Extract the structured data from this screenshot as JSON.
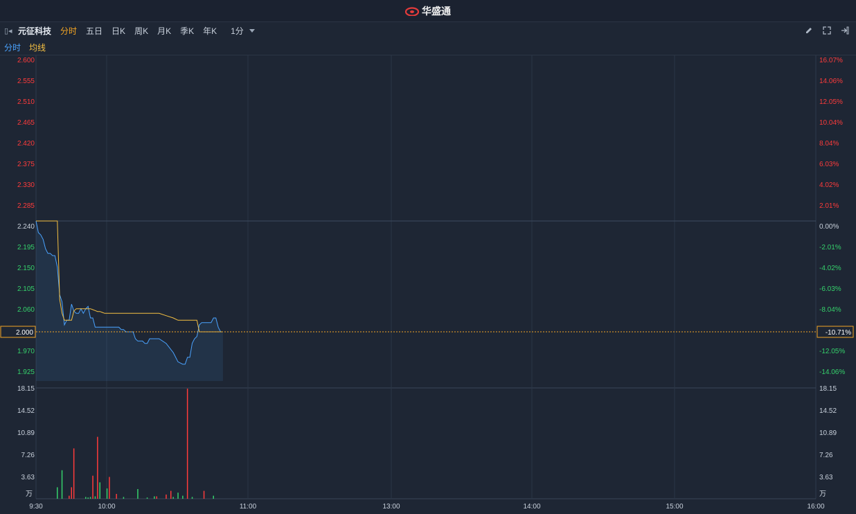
{
  "header": {
    "brand": "华盛通"
  },
  "toolbar": {
    "stock_name": "元征科技",
    "tabs": [
      "分时",
      "五日",
      "日K",
      "周K",
      "月K",
      "季K",
      "年K"
    ],
    "active_tab": "分时",
    "period": "1分"
  },
  "legend": {
    "price_label": "分时",
    "avg_label": "均线"
  },
  "colors": {
    "up": "#ff3b3b",
    "down": "#35d16b",
    "price_line": "#4aa3ff",
    "avg_line": "#f5c042",
    "current": "#f5a623"
  },
  "chart_data": {
    "type": "line",
    "prev_close": 2.24,
    "current_price": "2.000",
    "current_pct": "-10.71%",
    "price_ticks": [
      "2.600",
      "2.555",
      "2.510",
      "2.465",
      "2.420",
      "2.375",
      "2.330",
      "2.285",
      "2.240",
      "2.195",
      "2.150",
      "2.105",
      "2.060",
      "2.015",
      "1.970",
      "1.925"
    ],
    "pct_ticks": [
      "16.07%",
      "14.06%",
      "12.05%",
      "10.04%",
      "8.04%",
      "6.03%",
      "4.02%",
      "2.01%",
      "0.00%",
      "-2.01%",
      "-4.02%",
      "-6.03%",
      "-8.04%",
      "-10.04%",
      "-12.05%",
      "-14.06%"
    ],
    "volume_ticks": [
      "18.15",
      "14.52",
      "10.89",
      "7.26",
      "3.63"
    ],
    "volume_unit": "万",
    "time_labels": [
      "9:30",
      "10:00",
      "11:00",
      "13:00",
      "14:00",
      "15:00",
      "16:00"
    ],
    "price_minutes": [
      0,
      1,
      2,
      3,
      4,
      5,
      6,
      7,
      8,
      9,
      10,
      11,
      12,
      13,
      14,
      15,
      16,
      17,
      18,
      19,
      20,
      21,
      22,
      23,
      24,
      25,
      26,
      27,
      28,
      29,
      30,
      31,
      32,
      33,
      34,
      35,
      36,
      37,
      38,
      39,
      40,
      41,
      42,
      43,
      44,
      45,
      46,
      47,
      48,
      50,
      52,
      55,
      58,
      60,
      62,
      63,
      64,
      65,
      66,
      67,
      68,
      69,
      70,
      72,
      74,
      75,
      76,
      77,
      78,
      79
    ],
    "price": [
      2.24,
      2.215,
      2.21,
      2.2,
      2.18,
      2.17,
      2.17,
      2.165,
      2.165,
      2.14,
      2.08,
      2.065,
      2.015,
      2.025,
      2.025,
      2.06,
      2.045,
      2.04,
      2.04,
      2.05,
      2.04,
      2.05,
      2.055,
      2.03,
      2.03,
      2.01,
      2.01,
      2.01,
      2.01,
      2.01,
      2.01,
      2.01,
      2.01,
      2.01,
      2.01,
      2.01,
      2.005,
      2.005,
      2.0,
      2.0,
      2.0,
      2.0,
      1.985,
      1.98,
      1.98,
      1.98,
      1.975,
      1.975,
      1.985,
      1.985,
      1.985,
      1.975,
      1.955,
      1.935,
      1.93,
      1.93,
      1.945,
      1.945,
      1.975,
      1.985,
      1.99,
      2.015,
      2.02,
      2.02,
      2.02,
      2.03,
      2.03,
      2.01,
      2.0,
      2.0
    ],
    "avg": [
      2.24,
      2.24,
      2.24,
      2.24,
      2.24,
      2.24,
      2.24,
      2.24,
      2.24,
      2.24,
      2.07,
      2.04,
      2.025,
      2.025,
      2.025,
      2.025,
      2.045,
      2.05,
      2.05,
      2.05,
      2.05,
      2.05,
      2.05,
      2.05,
      2.048,
      2.046,
      2.044,
      2.044,
      2.042,
      2.04,
      2.04,
      2.04,
      2.04,
      2.04,
      2.04,
      2.04,
      2.04,
      2.04,
      2.04,
      2.04,
      2.04,
      2.04,
      2.04,
      2.04,
      2.04,
      2.04,
      2.04,
      2.04,
      2.04,
      2.04,
      2.04,
      2.035,
      2.03,
      2.025,
      2.025,
      2.025,
      2.025,
      2.025,
      2.025,
      2.025,
      2.025,
      2.0,
      2.0,
      2.0,
      2.0,
      2.0,
      2.0,
      2.0,
      2.0,
      2.0
    ],
    "volume_minutes": [
      9,
      11,
      14,
      15,
      16,
      21,
      22,
      23,
      24,
      25,
      26,
      27,
      30,
      31,
      34,
      37,
      43,
      47,
      50,
      51,
      55,
      57,
      58,
      60,
      62,
      64,
      66,
      71,
      75
    ],
    "volume": [
      1.9,
      4.7,
      0.5,
      1.9,
      8.3,
      0.3,
      0.2,
      0.3,
      3.8,
      0.4,
      10.2,
      2.7,
      1.7,
      3.6,
      0.8,
      0.3,
      1.6,
      0.2,
      0.4,
      0.4,
      0.7,
      1.3,
      0.3,
      1.0,
      0.5,
      18.15,
      0.3,
      1.3,
      0.5
    ],
    "volume_dir": [
      "down",
      "down",
      "up",
      "up",
      "up",
      "down",
      "down",
      "down",
      "up",
      "down",
      "up",
      "down",
      "down",
      "up",
      "up",
      "down",
      "down",
      "down",
      "down",
      "up",
      "up",
      "up",
      "down",
      "down",
      "down",
      "up",
      "down",
      "up",
      "down"
    ]
  }
}
